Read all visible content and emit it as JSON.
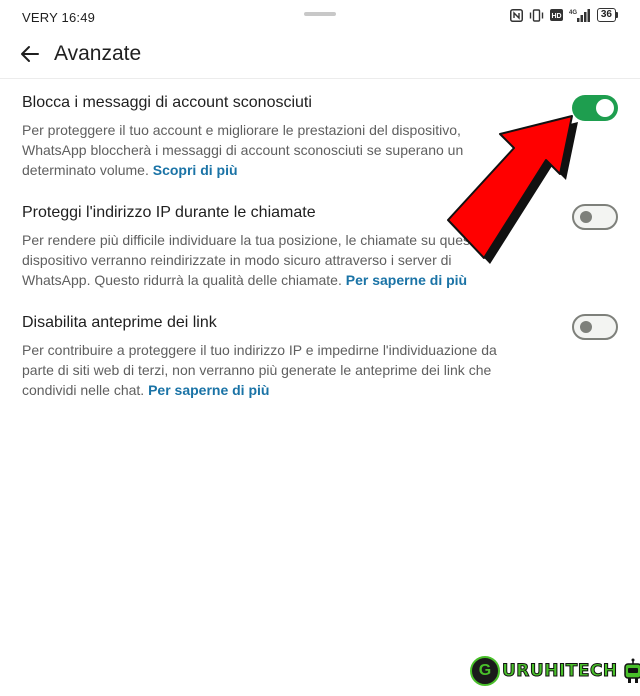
{
  "status_bar": {
    "carrier_time": "VERY 16:49",
    "battery": "36",
    "network": "4G"
  },
  "app_bar": {
    "title": "Avanzate"
  },
  "settings": [
    {
      "title": "Blocca i messaggi di account sconosciuti",
      "description": "Per proteggere il tuo account e migliorare le prestazioni del dispositivo, WhatsApp bloccherà i messaggi di account sconosciuti se superano un determinato volume.",
      "link": "Scopri di più",
      "enabled": true
    },
    {
      "title": "Proteggi l'indirizzo IP durante le chiamate",
      "description": "Per rendere più difficile individuare la tua posizione, le chiamate su questo dispositivo verranno reindirizzate in modo sicuro attraverso i server di WhatsApp. Questo ridurrà la qualità delle chiamate.",
      "link": "Per saperne di più",
      "enabled": false
    },
    {
      "title": "Disabilita anteprime dei link",
      "description": "Per contribuire a proteggere il tuo indirizzo IP e impedirne l'individuazione da parte di siti web di terzi, non verranno più generate le anteprime dei link che condividi nelle chat.",
      "link": "Per saperne di più",
      "enabled": false
    }
  ],
  "watermark": {
    "text": "URUHITECH",
    "initial": "G"
  },
  "colors": {
    "toggle_on": "#1e9e4f",
    "toggle_off_border": "#7e807b",
    "link": "#1a73a6",
    "arrow": "#ff0000",
    "watermark": "#49c02a"
  }
}
